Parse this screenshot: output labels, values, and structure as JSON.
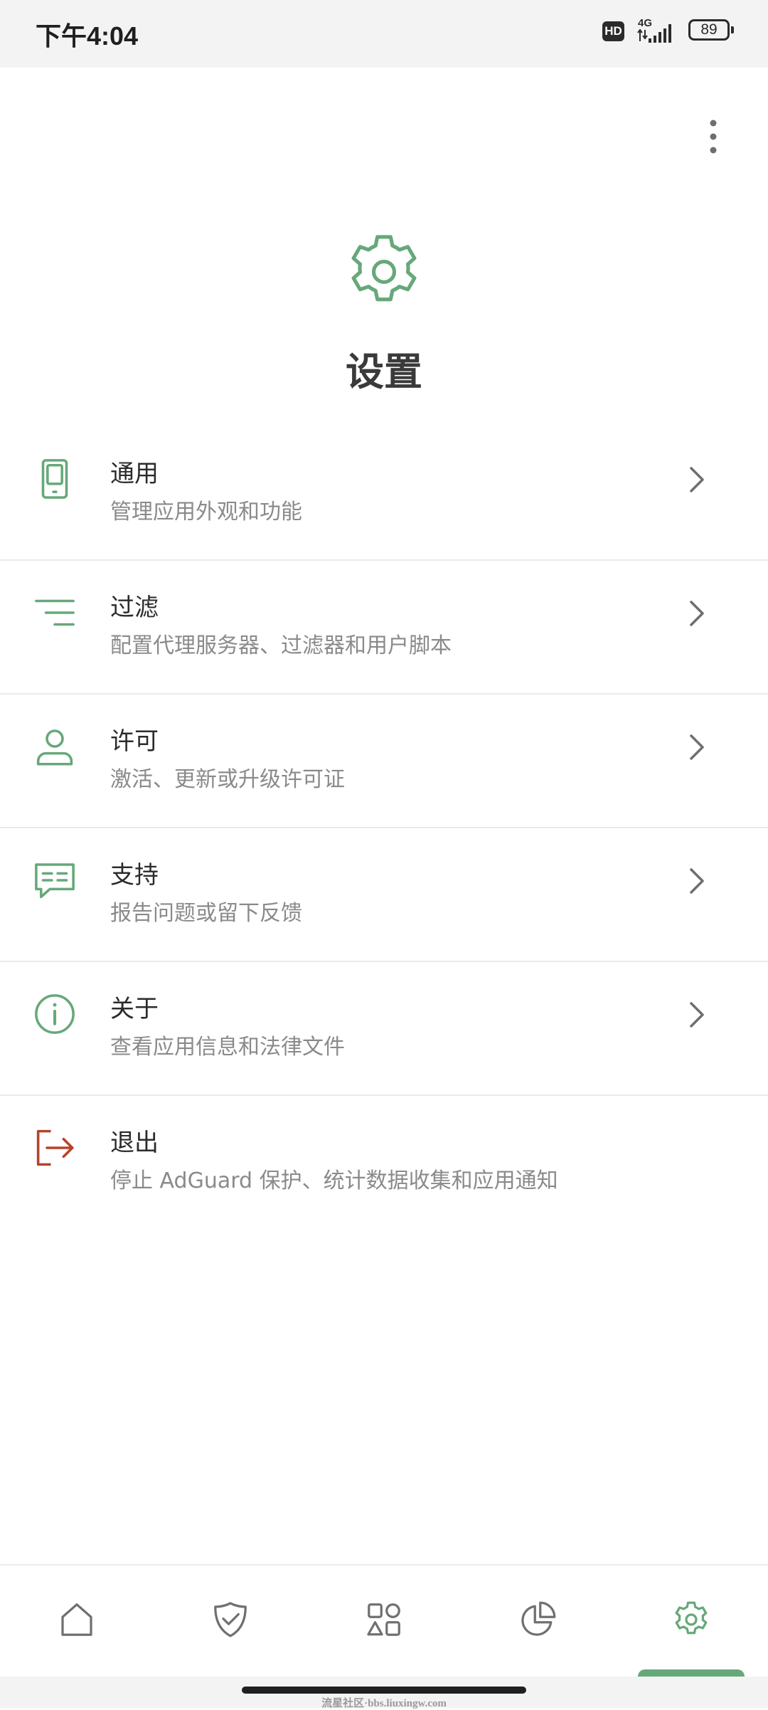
{
  "status_bar": {
    "time": "下午4:04",
    "hd_badge": "HD",
    "network": "4G",
    "battery_level": "89"
  },
  "header": {
    "title": "设置",
    "more_icon": "more-vertical-icon"
  },
  "menu": {
    "items": [
      {
        "icon": "phone-icon",
        "label": "通用",
        "subtitle": "管理应用外观和功能",
        "color": "#67a87a"
      },
      {
        "icon": "filter-icon",
        "label": "过滤",
        "subtitle": "配置代理服务器、过滤器和用户脚本",
        "color": "#67a87a"
      },
      {
        "icon": "person-icon",
        "label": "许可",
        "subtitle": "激活、更新或升级许可证",
        "color": "#67a87a"
      },
      {
        "icon": "chat-icon",
        "label": "支持",
        "subtitle": "报告问题或留下反馈",
        "color": "#67a87a"
      },
      {
        "icon": "info-icon",
        "label": "关于",
        "subtitle": "查看应用信息和法律文件",
        "color": "#67a87a"
      },
      {
        "icon": "logout-icon",
        "label": "退出",
        "subtitle": "停止 AdGuard 保护、统计数据收集和应用通知",
        "color": "#b5432a"
      }
    ]
  },
  "bottom_nav": {
    "tabs": [
      {
        "icon": "home-icon",
        "active": false
      },
      {
        "icon": "shield-check-icon",
        "active": false
      },
      {
        "icon": "apps-icon",
        "active": false
      },
      {
        "icon": "pie-chart-icon",
        "active": false
      },
      {
        "icon": "gear-icon",
        "active": true
      }
    ]
  },
  "colors": {
    "accent": "#67a87a",
    "danger": "#b5432a",
    "text_primary": "#2b2b2b",
    "text_secondary": "#8a8a8a",
    "nav_inactive": "#707070"
  },
  "watermark": "流星社区·bbs.liuxingw.com"
}
